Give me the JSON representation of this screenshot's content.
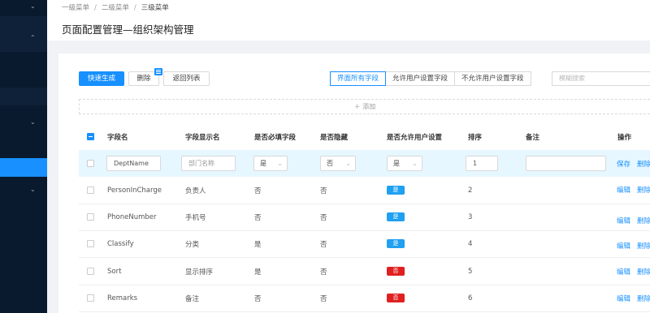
{
  "breadcrumb": {
    "level1": "一级菜单",
    "level2": "二级菜单",
    "level3": "三级菜单",
    "separator": "/"
  },
  "page_title": "页面配置管理—组织架构管理",
  "sidebar": {
    "chevrons": [
      "⌄",
      "⌃",
      "⌄",
      "⌄"
    ]
  },
  "toolbar": {
    "quick_generate": "快速生成",
    "delete": "删除",
    "back_list": "返回列表"
  },
  "field_filter": {
    "options": [
      "界面所有字段",
      "允许用户设置字段",
      "不允许用户设置字段"
    ],
    "active": 0
  },
  "search": {
    "placeholder": "模糊搜索"
  },
  "add_row": {
    "label": "＋ 添加"
  },
  "table": {
    "headers": [
      "字段名",
      "字段显示名",
      "是否必填字段",
      "是否隐藏",
      "是否允许用户设置",
      "排序",
      "备注",
      "操作"
    ],
    "edit_row": {
      "field_name": "DeptName",
      "display_placeholder": "部门名称",
      "required": "是",
      "hidden": "否",
      "allow_user": "是",
      "sort": "1",
      "remark": "",
      "actions": [
        "保存",
        "删除"
      ]
    },
    "rows": [
      {
        "field_name": "PersonInCharge",
        "display": "负责人",
        "required": "否",
        "hidden": "否",
        "allow_user": "是",
        "sort": "2"
      },
      {
        "field_name": "PhoneNumber",
        "display": "手机号",
        "required": "否",
        "hidden": "否",
        "allow_user": "是",
        "sort": "3"
      },
      {
        "field_name": "Classify",
        "display": "分类",
        "required": "是",
        "hidden": "否",
        "allow_user": "是",
        "sort": "4"
      },
      {
        "field_name": "Sort",
        "display": "显示排序",
        "required": "是",
        "hidden": "否",
        "allow_user": "否",
        "sort": "5"
      },
      {
        "field_name": "Remarks",
        "display": "备注",
        "required": "否",
        "hidden": "否",
        "allow_user": "否",
        "sort": "6"
      }
    ],
    "row_actions": [
      "编辑",
      "删除"
    ]
  },
  "colors": {
    "primary": "#1890ff",
    "danger": "#e02020",
    "sidebar": "#0a1a2e"
  }
}
